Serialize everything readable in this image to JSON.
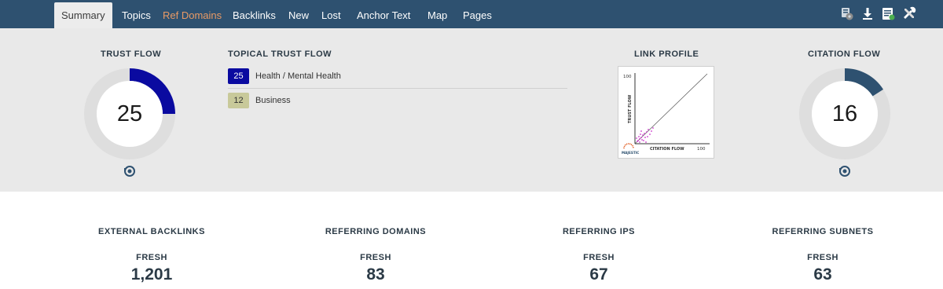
{
  "nav": {
    "tabs": [
      {
        "label": "Summary",
        "active": true
      },
      {
        "label": "Topics"
      },
      {
        "label": "Ref Domains",
        "highlight": true
      },
      {
        "label": "Backlinks"
      },
      {
        "label": "New"
      },
      {
        "label": "Lost"
      },
      {
        "label": "Anchor Text"
      },
      {
        "label": "Map"
      },
      {
        "label": "Pages"
      }
    ],
    "icons": [
      "settings-add-icon",
      "download-icon",
      "report-icon",
      "tools-icon"
    ],
    "bar_color": "#2e5170",
    "highlight_color": "#e89a65"
  },
  "trust_flow": {
    "title": "TRUST FLOW",
    "value": "25",
    "level": 0.25,
    "color": "#0a0aa0"
  },
  "topical_trust_flow": {
    "title": "TOPICAL TRUST FLOW",
    "items": [
      {
        "score": "25",
        "label": "Health / Mental Health",
        "color": "#0a0aa0",
        "text_color": "#ffffff"
      },
      {
        "score": "12",
        "label": "Business",
        "color": "#c8c99a",
        "text_color": "#333333"
      }
    ]
  },
  "link_profile": {
    "title": "LINK PROFILE",
    "ylabel": "TRUST FLOW",
    "xlabel": "CITATION FLOW",
    "y_tick": "100",
    "x_tick": "100",
    "logo_text": "MAJESTIC"
  },
  "citation_flow": {
    "title": "CITATION FLOW",
    "value": "16",
    "level": 0.16,
    "color": "#2e5170"
  },
  "stats": [
    {
      "title": "EXTERNAL BACKLINKS",
      "sub": "FRESH",
      "value": "1,201"
    },
    {
      "title": "REFERRING DOMAINS",
      "sub": "FRESH",
      "value": "83"
    },
    {
      "title": "REFERRING IPS",
      "sub": "FRESH",
      "value": "67"
    },
    {
      "title": "REFERRING SUBNETS",
      "sub": "FRESH",
      "value": "63"
    }
  ]
}
